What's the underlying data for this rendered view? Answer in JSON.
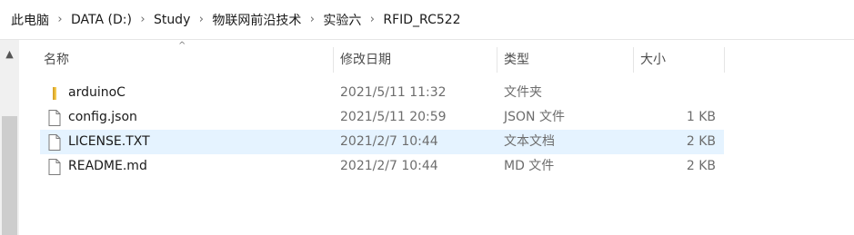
{
  "breadcrumb": [
    "此电脑",
    "DATA (D:)",
    "Study",
    "物联网前沿技术",
    "实验六",
    "RFID_RC522"
  ],
  "columns": {
    "name": "名称",
    "modified": "修改日期",
    "type": "类型",
    "size": "大小"
  },
  "sort_glyph": "^",
  "scroll_up_glyph": "▲",
  "separator_glyph": "›",
  "files": [
    {
      "name": "arduinoC",
      "modified": "2021/5/11 11:32",
      "type": "文件夹",
      "size": "",
      "icon": "folder-icon"
    },
    {
      "name": "config.json",
      "modified": "2021/5/11 20:59",
      "type": "JSON 文件",
      "size": "1 KB",
      "icon": "file-icon"
    },
    {
      "name": "LICENSE.TXT",
      "modified": "2021/2/7 10:44",
      "type": "文本文档",
      "size": "2 KB",
      "icon": "file-icon"
    },
    {
      "name": "README.md",
      "modified": "2021/2/7 10:44",
      "type": "MD 文件",
      "size": "2 KB",
      "icon": "file-icon"
    }
  ],
  "selected_index": 2,
  "colors": {
    "selection": "#e5f3ff",
    "folder": "#f4c84b"
  }
}
